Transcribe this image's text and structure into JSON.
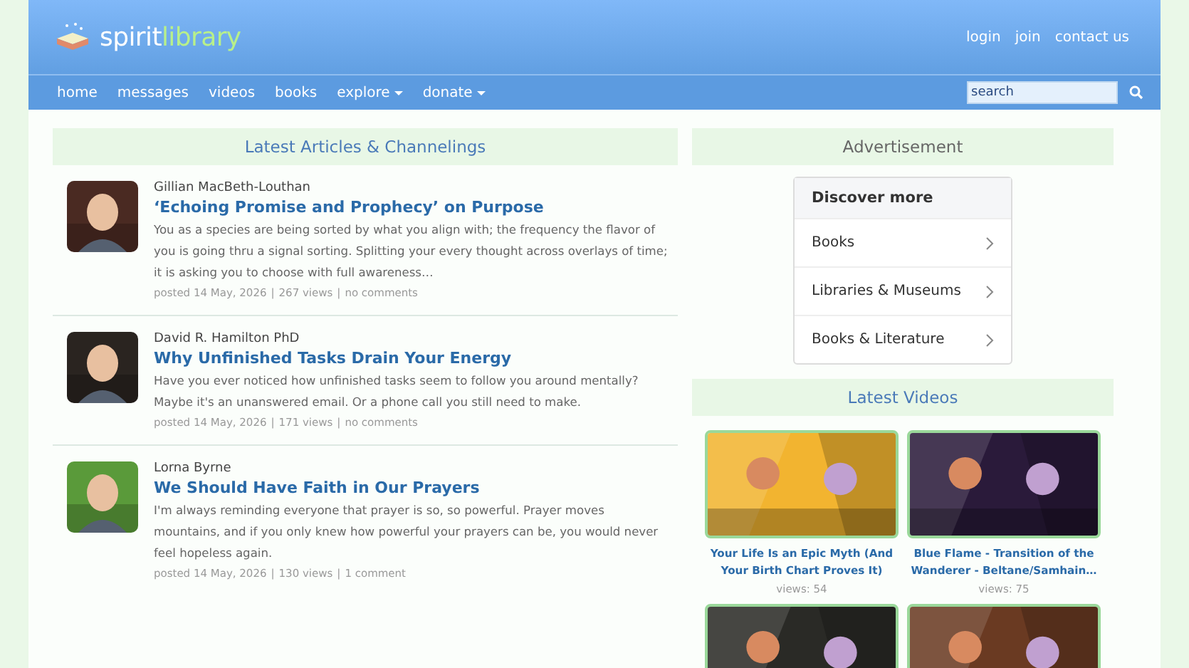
{
  "header": {
    "logo": {
      "first": "spirit",
      "second": "library"
    },
    "links": [
      "login",
      "join",
      "contact us"
    ]
  },
  "nav": {
    "items": [
      {
        "label": "home",
        "dropdown": false
      },
      {
        "label": "messages",
        "dropdown": false
      },
      {
        "label": "videos",
        "dropdown": false
      },
      {
        "label": "books",
        "dropdown": false
      },
      {
        "label": "explore",
        "dropdown": true
      },
      {
        "label": "donate",
        "dropdown": true
      }
    ],
    "search": {
      "placeholder": "search"
    }
  },
  "articles_section": {
    "title": "Latest Articles & Channelings",
    "articles": [
      {
        "author": "Gillian MacBeth-Louthan",
        "title": "‘Echoing Promise and Prophecy’ on Purpose",
        "excerpt": "You as a species are being sorted by what you align with; the frequency the flavor of you is going thru a signal sorting. Splitting your every thought across overlays of time; it is asking you to choose with full awareness…",
        "posted": "posted 14 May, 2026",
        "views": "267 views",
        "comments": "no comments",
        "separator": "|",
        "avatar": {
          "kind": "picture"
        }
      },
      {
        "author": "David R. Hamilton PhD",
        "title": "Why Unfinished Tasks Drain Your Energy",
        "excerpt": "Have you ever noticed how unfinished tasks seem to follow you around mentally?  Maybe it's an unanswered email. Or a phone call you still need to make.",
        "posted": "posted 14 May, 2026",
        "views": "171 views",
        "comments": "no comments",
        "separator": "|",
        "avatar": {
          "kind": "picture"
        }
      },
      {
        "author": "Lorna Byrne",
        "title": "We Should Have Faith in Our Prayers",
        "excerpt": "I'm always reminding everyone that prayer is so, so powerful. Prayer moves mountains, and if you only knew how powerful your prayers can be, you would never feel hopeless again.",
        "posted": "posted 14 May, 2026",
        "views": "130 views",
        "comments": "1 comment",
        "separator": "|",
        "avatar": {
          "kind": "picture"
        }
      }
    ]
  },
  "advertisement": {
    "title": "Advertisement",
    "heading": "Discover more",
    "items": [
      "Books",
      "Libraries & Museums",
      "Books & Literature"
    ]
  },
  "videos_section": {
    "title": "Latest Videos",
    "videos": [
      {
        "title": "Your Life Is an Epic Myth (And Your Birth Chart Proves It)",
        "views": "views: 54",
        "thumb": {
          "kind": "picture"
        }
      },
      {
        "title": "Blue Flame - Transition of the Wanderer - Beltane/Samhain…",
        "views": "views: 75",
        "thumb": {
          "kind": "picture"
        }
      },
      {
        "thumb": {
          "kind": "picture"
        }
      },
      {
        "thumb": {
          "kind": "picture"
        }
      }
    ]
  }
}
